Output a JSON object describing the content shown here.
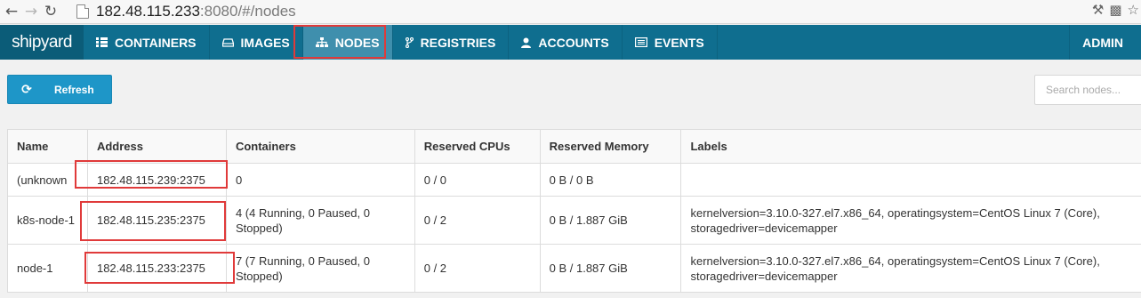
{
  "browser": {
    "url_host": "182.48.115.233",
    "url_rest": ":8080/#/nodes"
  },
  "nav": {
    "brand": "shipyard",
    "items": [
      {
        "label": "CONTAINERS",
        "icon": "grid-icon"
      },
      {
        "label": "IMAGES",
        "icon": "hdd-icon"
      },
      {
        "label": "NODES",
        "icon": "sitemap-icon",
        "active": true
      },
      {
        "label": "REGISTRIES",
        "icon": "code-fork-icon"
      },
      {
        "label": "ACCOUNTS",
        "icon": "user-icon"
      },
      {
        "label": "EVENTS",
        "icon": "list-icon"
      }
    ],
    "admin": "ADMIN"
  },
  "toolbar": {
    "refresh_label": "Refresh",
    "search_placeholder": "Search nodes..."
  },
  "table": {
    "headers": [
      "Name",
      "Address",
      "Containers",
      "Reserved CPUs",
      "Reserved Memory",
      "Labels"
    ],
    "rows": [
      [
        "(unknown",
        "182.48.115.239:2375",
        "0",
        "0 / 0",
        "0 B / 0 B",
        ""
      ],
      [
        "k8s-node-1",
        "182.48.115.235:2375",
        "4 (4 Running, 0 Paused, 0 Stopped)",
        "0 / 2",
        "0 B / 1.887 GiB",
        "kernelversion=3.10.0-327.el7.x86_64, operatingsystem=CentOS Linux 7 (Core), storagedriver=devicemapper"
      ],
      [
        "node-1",
        "182.48.115.233:2375",
        "7 (7 Running, 0 Paused, 0 Stopped)",
        "0 / 2",
        "0 B / 1.887 GiB",
        "kernelversion=3.10.0-327.el7.x86_64, operatingsystem=CentOS Linux 7 (Core), storagedriver=devicemapper"
      ]
    ]
  },
  "colors": {
    "navbar": "#0f6e8f",
    "brand_bg": "#0b5c78",
    "active_nav": "#3f8fad",
    "refresh_button": "#1e96c8",
    "highlight": "#e03a3a"
  }
}
